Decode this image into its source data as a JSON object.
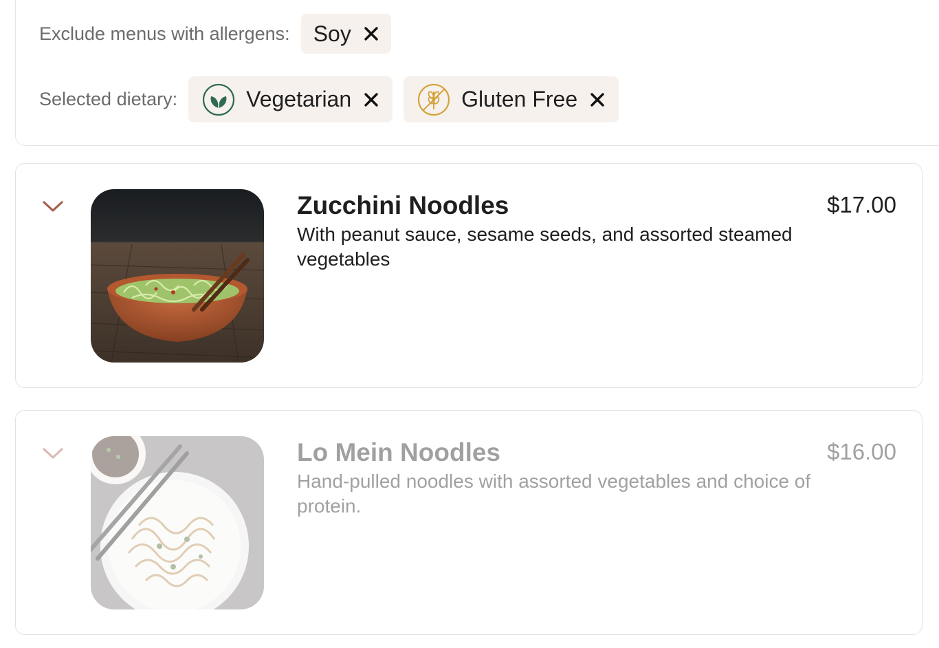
{
  "filters": {
    "allergens_label": "Exclude menus with allergens:",
    "allergens": [
      {
        "label": "Soy"
      }
    ],
    "dietary_label": "Selected dietary:",
    "dietary": [
      {
        "label": "Vegetarian",
        "icon": "leaf-icon",
        "color": "#2f6b50"
      },
      {
        "label": "Gluten Free",
        "icon": "gluten-free-icon",
        "color": "#d4a43c"
      }
    ]
  },
  "menu_items": [
    {
      "title": "Zucchini Noodles",
      "price": "$17.00",
      "description": "With peanut sauce, sesame seeds, and assorted steamed vegetables",
      "image": "zucchini-noodles-photo",
      "available": true
    },
    {
      "title": "Lo Mein Noodles",
      "price": "$16.00",
      "description": "Hand-pulled noodles with assorted vegetables and choice of protein.",
      "image": "lo-mein-noodles-photo",
      "available": false
    }
  ],
  "colors": {
    "accent": "#a5604e",
    "chip_bg": "#f7f1ee",
    "border": "#e2e2e2",
    "label": "#6b6b6b"
  }
}
